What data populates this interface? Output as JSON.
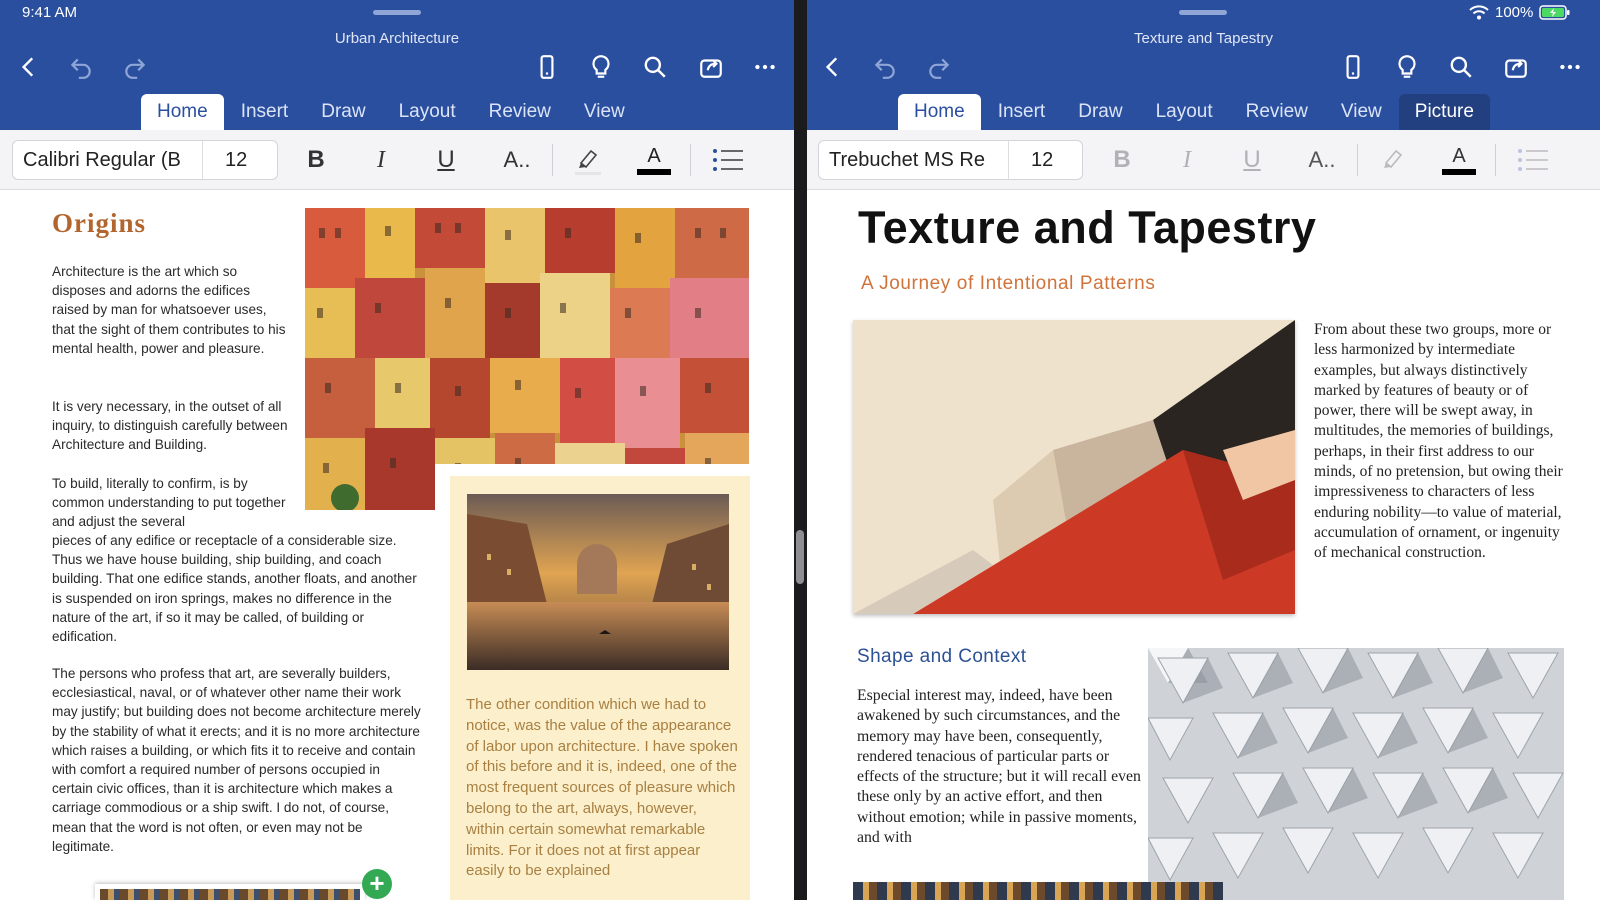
{
  "status": {
    "time": "9:41 AM",
    "battery": "100%"
  },
  "left": {
    "title": "Urban Architecture",
    "tabs": [
      "Home",
      "Insert",
      "Draw",
      "Layout",
      "Review",
      "View"
    ],
    "font_name": "Calibri Regular (B",
    "font_size": "12",
    "heading": "Origins",
    "para1": "Architecture is the art which so disposes and adorns the edifices raised by man for whatsoever uses, that the sight of them contributes to his mental health, power and pleasure.",
    "para2": "It is very necessary, in the outset of all inquiry, to distinguish carefully between Architecture and Building.",
    "para3a": "To build, literally to confirm, is by common understanding to put together and adjust the several",
    "para3b": "pieces of any edifice or receptacle of a considerable size. Thus we have house building, ship building, and coach building. That one edifice stands, another floats, and another is suspended on iron springs, makes no difference in the nature of the art, if so it may be called, of building or edification.",
    "para4": "The persons who profess that art, are severally builders, ecclesiastical, naval, or of whatever other name their work may justify; but building does not become architecture merely by the stability of what it erects; and it is no more architecture which raises a building, or which fits it to receive and contain with comfort a required number of persons occupied in certain civic offices, than it is architecture which makes a carriage commodious or a ship swift. I do not, of course, mean that the word is not often, or even may not be legitimate.",
    "callout": "The other condition which we had to notice, was the value of the appearance of labor upon architecture. I have spoken of this before and it is, indeed, one of the most frequent sources of pleasure which belong to the art, always, however, within certain somewhat remarkable limits. For it does not at first appear easily to be explained"
  },
  "right": {
    "title": "Texture and Tapestry",
    "tabs": [
      "Home",
      "Insert",
      "Draw",
      "Layout",
      "Review",
      "View",
      "Picture"
    ],
    "font_name": "Trebuchet MS Re",
    "font_size": "12",
    "doc_title": "Texture and Tapestry",
    "subtitle": "A Journey of Intentional Patterns",
    "side_text": "From about these two groups, more or less harmonized by intermediate examples, but always distinctively marked by features of beauty or of power, there will be swept away, in multitudes, the memories of buildings, perhaps, in their first address to our minds, of no pretension, but owing their impressiveness to characters of less enduring nobility—to value of material, accumulation of ornament, or ingenuity of mechanical construction.",
    "section_heading": "Shape and Context",
    "body": "Especial interest may, indeed, have been awakened by such circumstances, and the memory may have been, consequently, rendered tenacious of particular parts or effects of the structure; but it will recall even these only by an active effort, and then without emotion; while in passive moments, and with"
  },
  "ribbon": {
    "bold": "B",
    "italic": "I",
    "underline": "U",
    "text_effects": "A..",
    "font_color": "A"
  },
  "colors": {
    "toolbar": "#2b4f9f",
    "accent_heading": "#b3652e",
    "subtitle": "#d0733a",
    "section_heading": "#2c5294",
    "callout_bg": "#fbefcc",
    "callout_text": "#a98042"
  }
}
